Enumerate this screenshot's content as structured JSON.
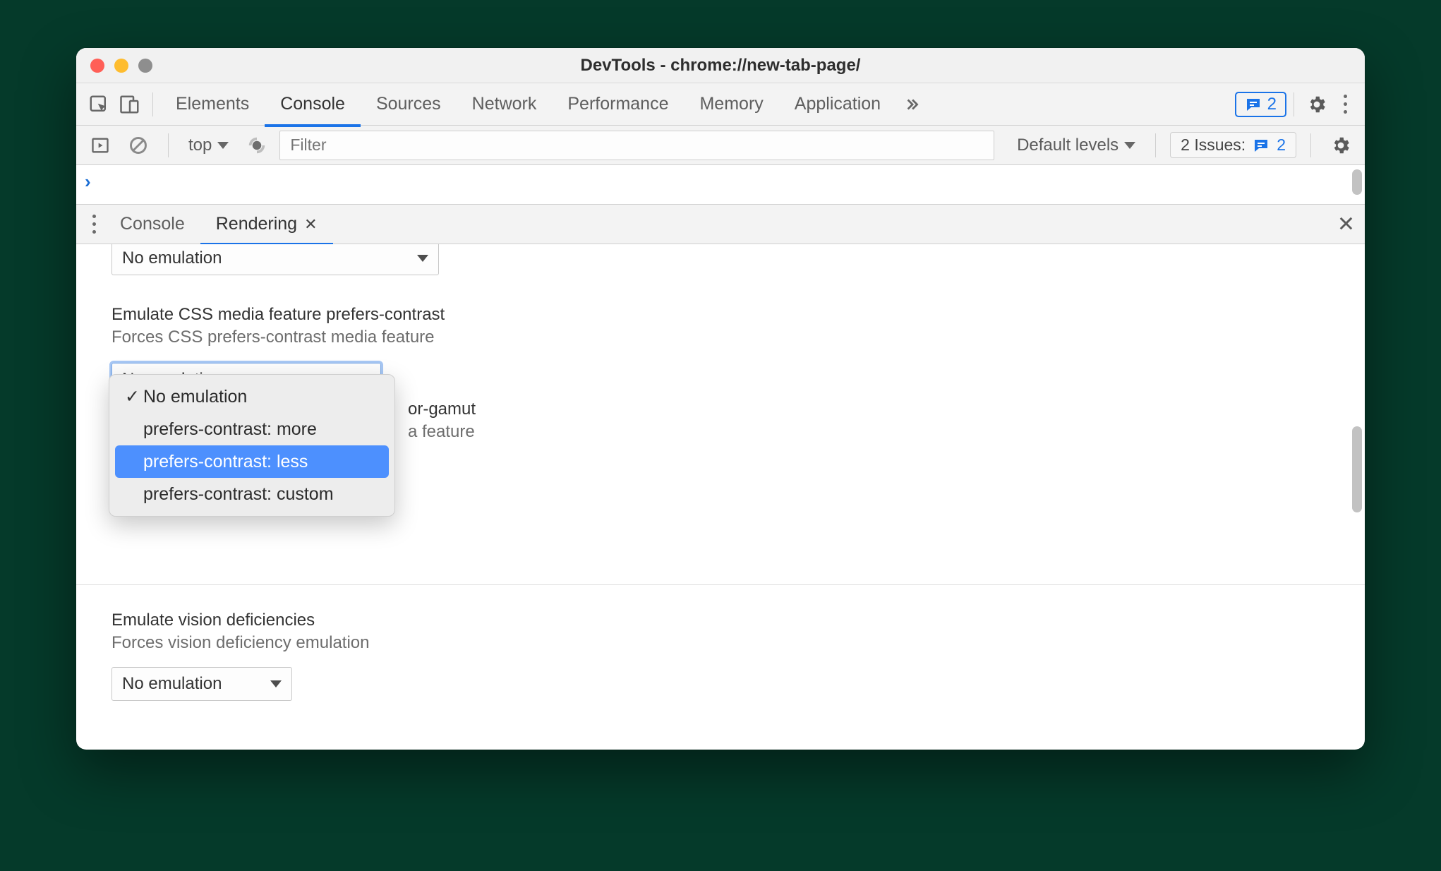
{
  "title": "DevTools - chrome://new-tab-page/",
  "tabs": {
    "elements": "Elements",
    "console": "Console",
    "sources": "Sources",
    "network": "Network",
    "performance": "Performance",
    "memory": "Memory",
    "application": "Application"
  },
  "messages_badge": "2",
  "console_toolbar": {
    "context": "top",
    "filter_placeholder": "Filter",
    "levels": "Default levels",
    "issues_label": "2 Issues:",
    "issues_count": "2"
  },
  "drawer": {
    "console": "Console",
    "rendering": "Rendering"
  },
  "rendering": {
    "select1_value": "No emulation",
    "block2_title": "Emulate CSS media feature prefers-contrast",
    "block2_desc": "Forces CSS prefers-contrast media feature",
    "block2_value": "No emulation",
    "block3_title_partial": "or-gamut",
    "block3_desc_partial": "a feature",
    "block4_title": "Emulate vision deficiencies",
    "block4_desc": "Forces vision deficiency emulation",
    "block4_value": "No emulation"
  },
  "dropdown": {
    "opt0": "No emulation",
    "opt1": "prefers-contrast: more",
    "opt2": "prefers-contrast: less",
    "opt3": "prefers-contrast: custom"
  }
}
